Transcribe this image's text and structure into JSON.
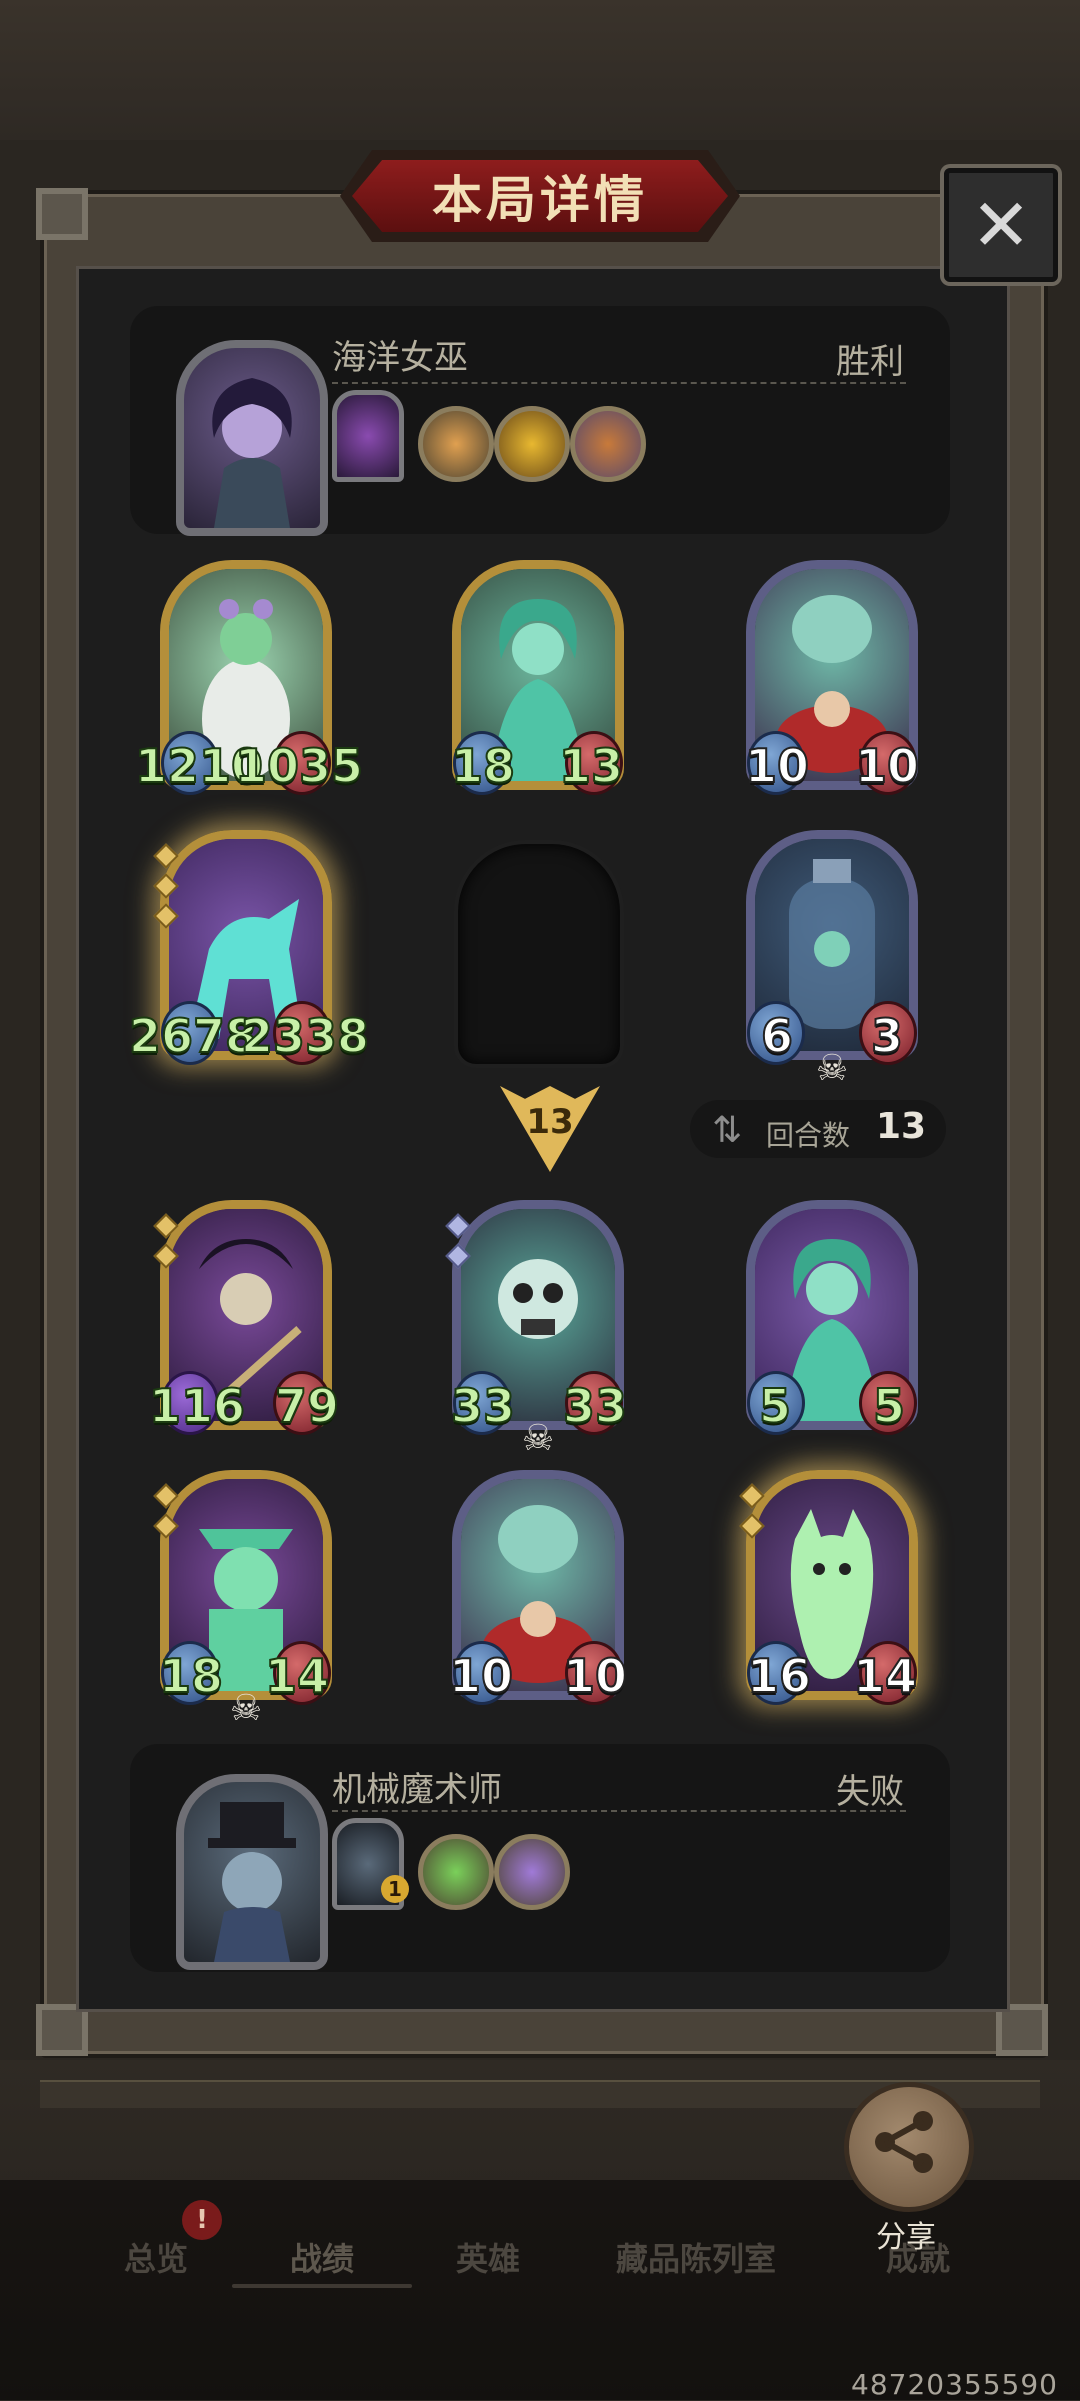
{
  "title": "本局详情",
  "close_label": "✕",
  "top_player": {
    "name": "海洋女巫",
    "result": "胜利"
  },
  "bottom_player": {
    "name": "机械魔术师",
    "result": "失败",
    "hero_level": "1"
  },
  "turn_marker": "13",
  "round": {
    "label": "回合数",
    "value": "13"
  },
  "cards": [
    {
      "id": "c1",
      "attack": "1210",
      "health": "1035"
    },
    {
      "id": "c2",
      "attack": "18",
      "health": "13"
    },
    {
      "id": "c3",
      "attack": "10",
      "health": "10"
    },
    {
      "id": "c4",
      "attack": "2678",
      "health": "2338"
    },
    {
      "id": "c5",
      "attack": "6",
      "health": "3"
    },
    {
      "id": "c6",
      "attack": "116",
      "health": "79"
    },
    {
      "id": "c7",
      "attack": "33",
      "health": "33"
    },
    {
      "id": "c8",
      "attack": "5",
      "health": "5"
    },
    {
      "id": "c9",
      "attack": "18",
      "health": "14"
    },
    {
      "id": "c10",
      "attack": "10",
      "health": "10"
    },
    {
      "id": "c11",
      "attack": "16",
      "health": "14"
    }
  ],
  "share_label": "分享",
  "nav": {
    "overview": "总览",
    "overview_badge": "!",
    "record": "战绩",
    "heroes": "英雄",
    "collection": "藏品陈列室",
    "achievements": "成就"
  },
  "user_id": "48720355590",
  "skull_glyph": "☠",
  "round_icon_glyph": "⇅"
}
